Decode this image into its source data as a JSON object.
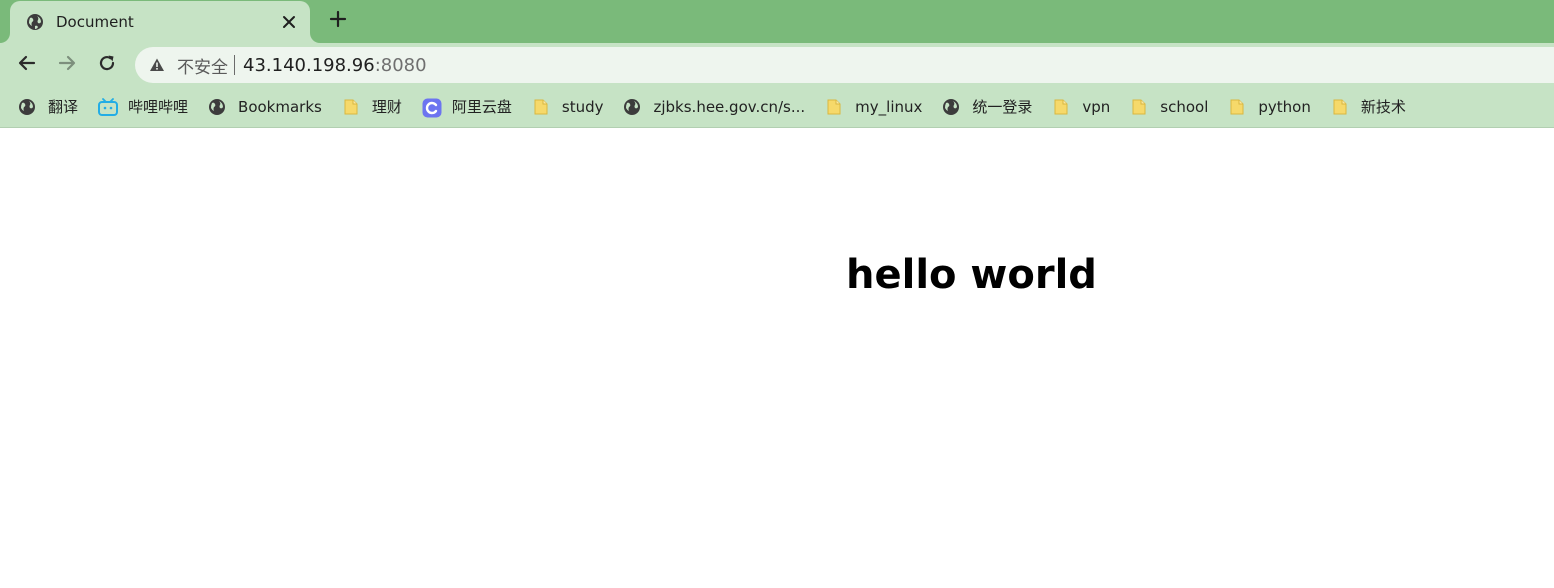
{
  "colors": {
    "frame_green": "#7aba7a",
    "tab_active": "#c6e3c5",
    "folder_yellow": "#f6d96a",
    "bilibili_blue": "#23ade5",
    "aliyun_purple": "#6c74f0"
  },
  "tab": {
    "title": "Document",
    "favicon": "globe-icon",
    "close_icon": "close-icon"
  },
  "new_tab_icon": "plus-icon",
  "toolbar": {
    "back_icon": "arrow-left-icon",
    "forward_icon": "arrow-right-icon",
    "reload_icon": "reload-icon"
  },
  "omnibox": {
    "warning_icon": "warning-triangle-icon",
    "security_label": "不安全",
    "host": "43.140.198.96",
    "port": ":8080"
  },
  "bookmarks": [
    {
      "label": "翻译",
      "icon": "globe-icon"
    },
    {
      "label": "哔哩哔哩",
      "icon": "bilibili-icon"
    },
    {
      "label": "Bookmarks",
      "icon": "globe-icon"
    },
    {
      "label": "理财",
      "icon": "folder-icon"
    },
    {
      "label": "阿里云盘",
      "icon": "aliyun-drive-icon"
    },
    {
      "label": "study",
      "icon": "folder-icon"
    },
    {
      "label": "zjbks.hee.gov.cn/s...",
      "icon": "globe-icon"
    },
    {
      "label": "my_linux",
      "icon": "folder-icon"
    },
    {
      "label": "统一登录",
      "icon": "globe-icon"
    },
    {
      "label": "vpn",
      "icon": "folder-icon"
    },
    {
      "label": "school",
      "icon": "folder-icon"
    },
    {
      "label": "python",
      "icon": "folder-icon"
    },
    {
      "label": "新技术",
      "icon": "folder-icon"
    }
  ],
  "page": {
    "heading": "hello world"
  }
}
